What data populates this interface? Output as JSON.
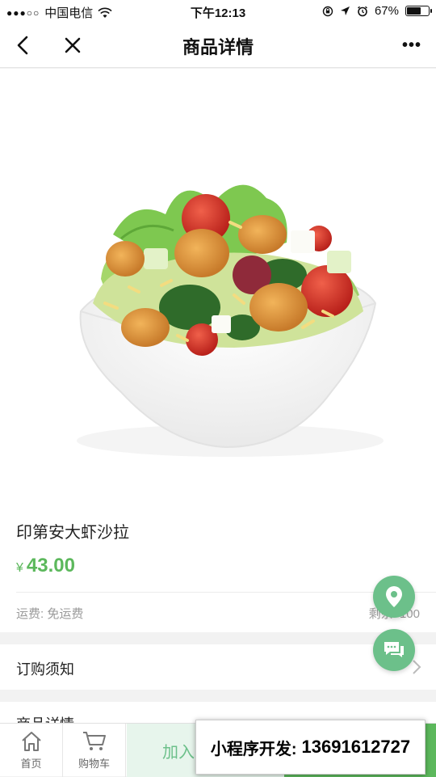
{
  "status_bar": {
    "signal": "●●●○○",
    "carrier": "中国电信",
    "time": "下午12:13",
    "battery": "67%",
    "battery_level": 0.67
  },
  "nav": {
    "title": "商品详情",
    "more": "•••"
  },
  "product": {
    "name": "印第安大虾沙拉",
    "currency": "¥",
    "price": "43.00",
    "shipping": "运费: 免运费",
    "stock": "剩余: 100"
  },
  "sections": {
    "notice": "订购须知",
    "detail": "商品详情"
  },
  "tabbar": {
    "home": "首页",
    "cart": "购物车",
    "add_to_cart": "加入"
  },
  "promo": {
    "label": "小程序开发:",
    "number": "13691612727"
  },
  "colors": {
    "accent": "#5cb85c",
    "fab": "#6cc08a"
  }
}
